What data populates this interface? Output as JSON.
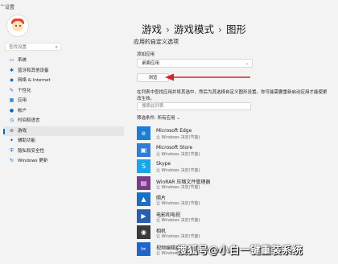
{
  "window": {
    "title": "设置",
    "back": "←"
  },
  "search": {
    "placeholder": "查找设置"
  },
  "nav": [
    {
      "label": "系统",
      "icon": "monitor-icon",
      "glyph": "▭"
    },
    {
      "label": "蓝牙和其他设备",
      "icon": "bluetooth-icon",
      "glyph": "✱"
    },
    {
      "label": "网络 & Internet",
      "icon": "wifi-icon",
      "glyph": "◆"
    },
    {
      "label": "个性化",
      "icon": "brush-icon",
      "glyph": "✎"
    },
    {
      "label": "应用",
      "icon": "apps-icon",
      "glyph": "▦"
    },
    {
      "label": "帐户",
      "icon": "account-icon",
      "glyph": "●"
    },
    {
      "label": "时间和语言",
      "icon": "clock-icon",
      "glyph": "◷"
    },
    {
      "label": "游戏",
      "icon": "gamepad-icon",
      "glyph": "⊛"
    },
    {
      "label": "辅助功能",
      "icon": "accessibility-icon",
      "glyph": "✦"
    },
    {
      "label": "隐私和安全性",
      "icon": "shield-icon",
      "glyph": "⛨"
    },
    {
      "label": "Windows 更新",
      "icon": "update-icon",
      "glyph": "↻"
    }
  ],
  "breadcrumb": {
    "part1": "游戏",
    "sep": "›",
    "part2": "游戏模式",
    "part3": "图形"
  },
  "section": {
    "title": "应用的自定义选项",
    "add_label": "添加应用",
    "select_value": "桌面应用",
    "browse": "浏览"
  },
  "desc": "在列表中查找应用并将其选中，然后为其选择自定义图形设置。你可能需要重新启动应用才能使更改生效。",
  "list_search": {
    "placeholder": "搜索此列表"
  },
  "filter": {
    "label": "筛选条件: 所有应用"
  },
  "apps": [
    {
      "name": "Microsoft Edge",
      "sub": "让 Windows 决定(节能)",
      "icon": "edge-icon",
      "color": "#1a7fd6",
      "glyph": "e"
    },
    {
      "name": "Microsoft Store",
      "sub": "让 Windows 决定(节能)",
      "icon": "store-icon",
      "color": "#2f7cd9",
      "glyph": "▣"
    },
    {
      "name": "Skype",
      "sub": "让 Windows 决定(节能)",
      "icon": "skype-icon",
      "color": "#1aa5e6",
      "glyph": "S"
    },
    {
      "name": "WinRAR 压缩文件管理器",
      "sub": "让 Windows 决定(节能)",
      "icon": "winrar-icon",
      "color": "#7a3c8a",
      "glyph": "▤"
    },
    {
      "name": "照片",
      "sub": "让 Windows 决定(节能)",
      "icon": "photos-icon",
      "color": "#1b6fc2",
      "glyph": "▲"
    },
    {
      "name": "电影和电视",
      "sub": "让 Windows 决定(节能)",
      "icon": "movies-icon",
      "color": "#2a5fb0",
      "glyph": "▶"
    },
    {
      "name": "相机",
      "sub": "让 Windows 决定(节能)",
      "icon": "camera-icon",
      "color": "#3a3a3a",
      "glyph": "◉"
    },
    {
      "name": "视频编辑器",
      "sub": "让 Windows 决定(节能)",
      "icon": "video-editor-icon",
      "color": "#1f66c9",
      "glyph": "✂"
    }
  ],
  "watermark": "搜狐号@小白一键重装系统",
  "colors": {
    "accent": "#0067c0",
    "arrow": "#d9232b"
  }
}
